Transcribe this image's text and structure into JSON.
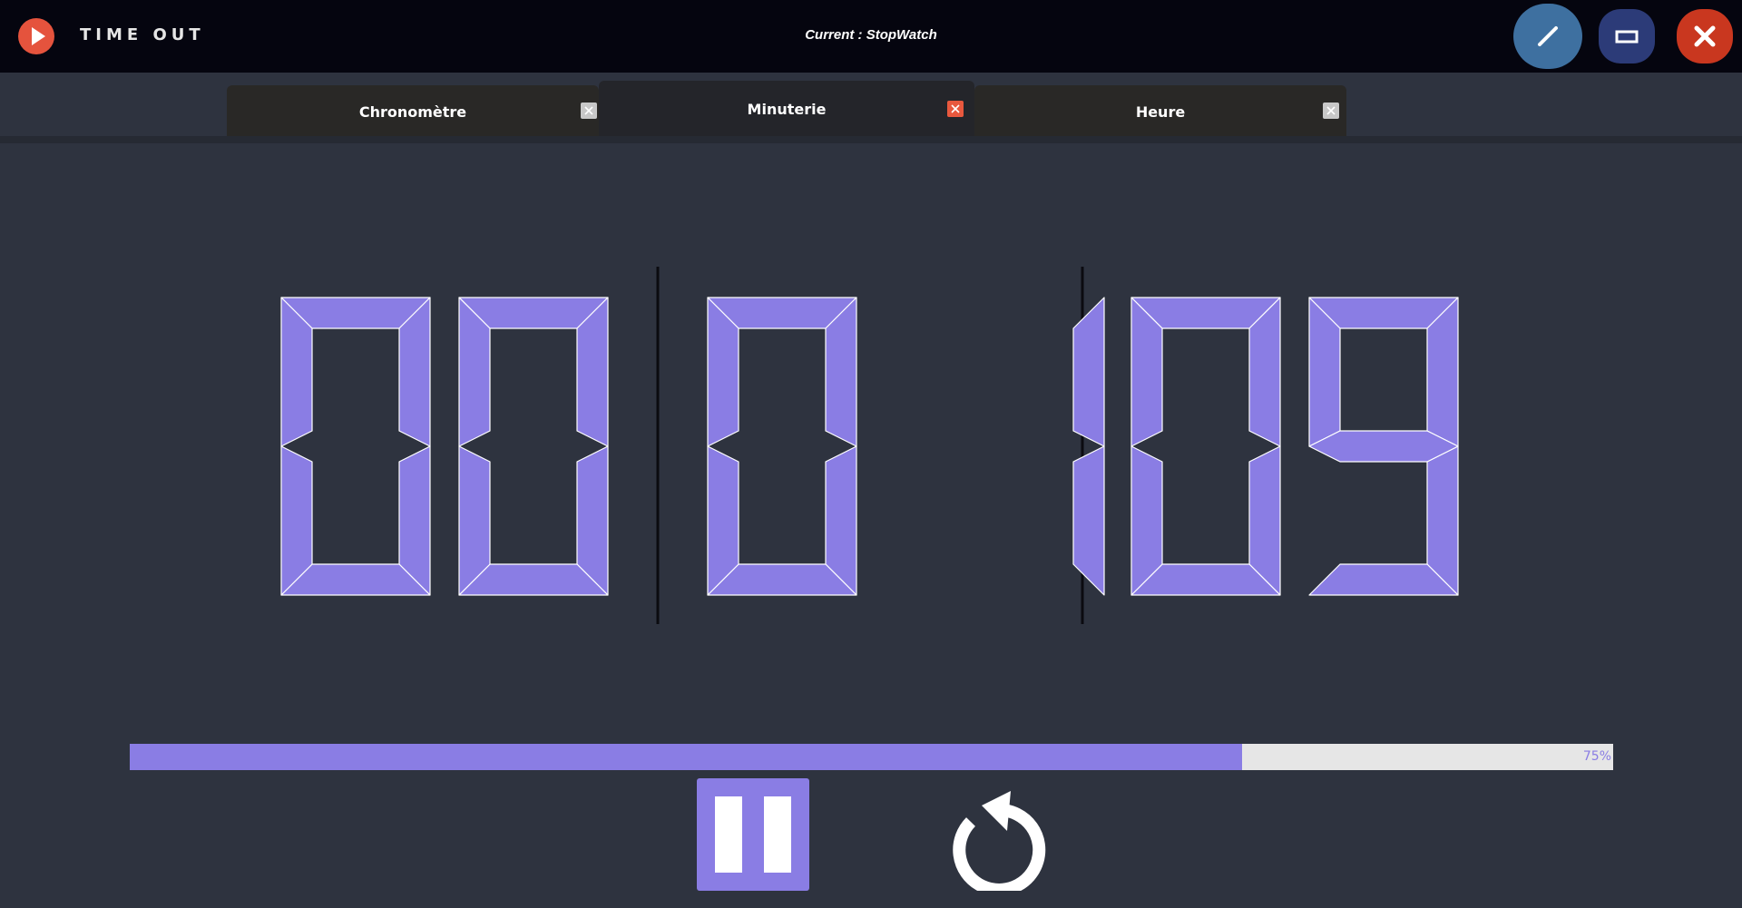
{
  "app": {
    "title": "TIME OUT",
    "current_label": "Current : StopWatch"
  },
  "window_buttons": [
    "edit-icon",
    "maximize-icon",
    "close-icon"
  ],
  "tabs": [
    {
      "label": "Chronomètre",
      "active": false
    },
    {
      "label": "Minuterie",
      "active": true
    },
    {
      "label": "Heure",
      "active": false
    }
  ],
  "timer": {
    "digits": [
      "0",
      "0",
      "0",
      "1",
      "0",
      "9"
    ],
    "color": "#8a7de4"
  },
  "progress": {
    "value": 0.75,
    "text": "75%"
  },
  "controls": {
    "pause": "pause-icon",
    "reset": "reset-icon"
  },
  "colors": {
    "accent": "#8a7de4",
    "logo": "#e5533d",
    "edit_button": "#3e70a0",
    "maximize_button": "#2c3b78",
    "close_button": "#c9371f",
    "active_tab_close": "#e8583e"
  }
}
